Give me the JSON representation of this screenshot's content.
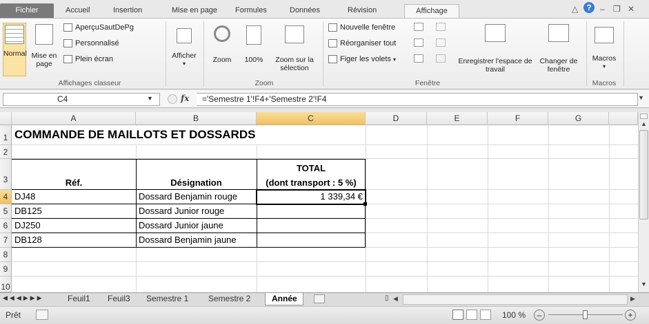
{
  "tabs": [
    "Fichier",
    "Accueil",
    "Insertion",
    "Mise en page",
    "Formules",
    "Données",
    "Révision",
    "Affichage"
  ],
  "ribbon": {
    "normal": "Normal",
    "mise_en_page": "Mise en page",
    "apercu": "AperçuSautDePg",
    "personnalise": "Personnalisé",
    "plein_ecran": "Plein écran",
    "group_affichages": "Affichages classeur",
    "afficher": "Afficher",
    "zoom": "Zoom",
    "zoom100": "100%",
    "zoom_sel": "Zoom sur la sélection",
    "group_zoom": "Zoom",
    "nouvelle_fenetre": "Nouvelle fenêtre",
    "reorganiser": "Réorganiser tout",
    "figer": "Figer les volets",
    "enregistrer": "Enregistrer l'espace de travail",
    "changer": "Changer de fenêtre",
    "group_fenetre": "Fenêtre",
    "macros": "Macros",
    "group_macros": "Macros"
  },
  "formula_bar": {
    "name_box": "C4",
    "fx": "fx",
    "formula": "='Semestre 1'!F4+'Semestre 2'!F4"
  },
  "columns": [
    "A",
    "B",
    "C",
    "D",
    "E",
    "F",
    "G"
  ],
  "rows": [
    "1",
    "2",
    "3",
    "4",
    "5",
    "6",
    "7",
    "8",
    "9",
    "10"
  ],
  "sheet": {
    "title": "COMMANDE DE MAILLOTS ET DOSSARDS",
    "hdr_ref": "Réf.",
    "hdr_designation": "Désignation",
    "hdr_total_1": "TOTAL",
    "hdr_total_2": "(dont transport : 5 %)",
    "items": [
      {
        "ref": "DJ48",
        "designation": "Dossard Benjamin rouge",
        "total": "1 339,34 €"
      },
      {
        "ref": "DB125",
        "designation": "Dossard Junior rouge",
        "total": ""
      },
      {
        "ref": "DJ250",
        "designation": "Dossard Junior jaune",
        "total": ""
      },
      {
        "ref": "DB128",
        "designation": "Dossard Benjamin jaune",
        "total": ""
      }
    ]
  },
  "sheet_tabs": [
    "Feuil1",
    "Feuil3",
    "Semestre 1",
    "Semestre 2",
    "Année"
  ],
  "status": {
    "ready": "Prêt",
    "zoom": "100 %"
  }
}
